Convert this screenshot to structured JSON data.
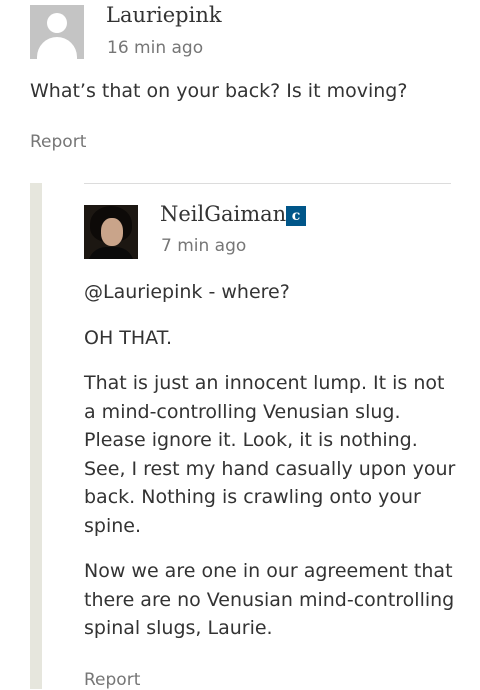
{
  "comment": {
    "author": "Lauriepink",
    "timestamp": "16 min ago",
    "text": "What’s that on your back? Is it moving?",
    "report_label": "Report"
  },
  "reply": {
    "author": "NeilGaiman",
    "badge": "c",
    "badge_color": "#005689",
    "timestamp": "7 min ago",
    "paragraphs": [
      "@Lauriepink - where?",
      "OH THAT.",
      "That is just an innocent lump. It is not a mind-controlling Venusian slug. Please ignore it. Look, it is nothing. See, I rest my hand casually upon your back. Nothing is crawling onto your spine.",
      "Now we are one in our agreement that there are no Venusian mind-controlling spinal slugs, Laurie."
    ],
    "report_label": "Report"
  },
  "colors": {
    "text": "#333333",
    "meta_text": "#767676",
    "thread_rail": "#e6e6dd"
  },
  "icons": {
    "default_avatar": "default-user-avatar-icon",
    "staff_badge": "staff-badge-icon"
  }
}
